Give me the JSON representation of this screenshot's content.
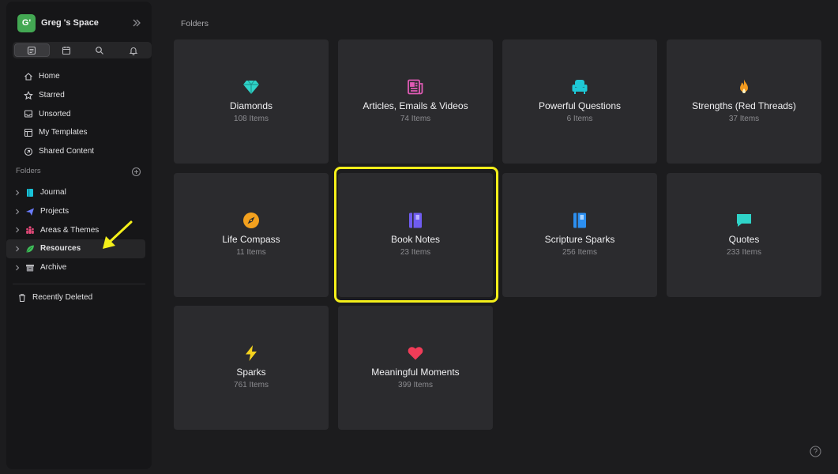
{
  "space": {
    "avatar": "G'",
    "name": "Greg 's Space"
  },
  "view_tabs": [
    "notes-icon",
    "calendar-icon",
    "search-icon",
    "bell-icon"
  ],
  "nav": [
    {
      "label": "Home",
      "icon": "home-icon"
    },
    {
      "label": "Starred",
      "icon": "star-icon"
    },
    {
      "label": "Unsorted",
      "icon": "inbox-icon"
    },
    {
      "label": "My Templates",
      "icon": "template-icon"
    },
    {
      "label": "Shared Content",
      "icon": "share-icon"
    }
  ],
  "sidebar_folders_label": "Folders",
  "folder_tree": [
    {
      "label": "Journal",
      "icon": "journal-icon",
      "color": "#19c2d8"
    },
    {
      "label": "Projects",
      "icon": "send-icon",
      "color": "#6b7dff"
    },
    {
      "label": "Areas & Themes",
      "icon": "people-icon",
      "color": "#e74a7b"
    },
    {
      "label": "Resources",
      "icon": "leaf-icon",
      "color": "#3fbf5a"
    },
    {
      "label": "Archive",
      "icon": "archive-icon",
      "color": "#b9b9bd"
    }
  ],
  "recently_deleted": "Recently Deleted",
  "main": {
    "title": "Folders",
    "cards": [
      {
        "title": "Diamonds",
        "count": "108 Items",
        "icon": "diamond-icon",
        "color": "#2fd3c8"
      },
      {
        "title": "Articles, Emails & Videos",
        "count": "74 Items",
        "icon": "newspaper-icon",
        "color": "#e05bb5"
      },
      {
        "title": "Powerful Questions",
        "count": "6 Items",
        "icon": "armchair-icon",
        "color": "#1ec8d6"
      },
      {
        "title": "Strengths (Red Threads)",
        "count": "37 Items",
        "icon": "flame-icon",
        "color": "#f39a1e"
      },
      {
        "title": "Life Compass",
        "count": "11 Items",
        "icon": "compass-icon",
        "color": "#f3a11e"
      },
      {
        "title": "Book Notes",
        "count": "23 Items",
        "icon": "book-icon",
        "color": "#6f5cf0"
      },
      {
        "title": "Scripture Sparks",
        "count": "256 Items",
        "icon": "bible-icon",
        "color": "#2c8ff0"
      },
      {
        "title": "Quotes",
        "count": "233 Items",
        "icon": "chat-bubble-icon",
        "color": "#2fd3c8"
      },
      {
        "title": "Sparks",
        "count": "761 Items",
        "icon": "lightning-icon",
        "color": "#f5d31e"
      },
      {
        "title": "Meaningful Moments",
        "count": "399 Items",
        "icon": "heart-icon",
        "color": "#f03c58"
      }
    ]
  },
  "colors": {
    "highlight": "#f4ef1a",
    "arrow": "#f4ef1a",
    "accent_space": "#43a853"
  }
}
